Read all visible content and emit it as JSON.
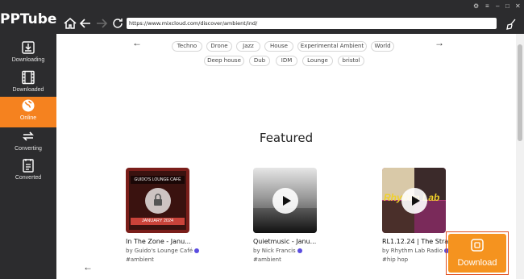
{
  "app": {
    "name": "PPTube"
  },
  "sidebar": {
    "items": [
      {
        "label": "Downloading",
        "icon": "download-icon"
      },
      {
        "label": "Downloaded",
        "icon": "film-icon"
      },
      {
        "label": "Online",
        "icon": "globe-icon",
        "active": true
      },
      {
        "label": "Converting",
        "icon": "convert-icon"
      },
      {
        "label": "Converted",
        "icon": "document-icon"
      }
    ]
  },
  "browser": {
    "url": "https://www.mixcloud.com/discover/ambient/ind/"
  },
  "tags_row1": [
    "Techno",
    "Drone",
    "Jazz",
    "House",
    "Experimental Ambient",
    "World"
  ],
  "tags_row2": [
    "Deep house",
    "Dub",
    "IDM",
    "Lounge",
    "bristol"
  ],
  "section_title": "Featured",
  "cards": [
    {
      "title": "In The Zone - Janu...",
      "by": "by Guido's Lounge Café",
      "tag": "#ambient",
      "art_text": "GUIDO'S LOUNGE CAFÉ",
      "art_sub": "JANUARY 2024"
    },
    {
      "title": "Quietmusic - Janu...",
      "by": "by Nick Francis",
      "tag": "#ambient"
    },
    {
      "title": "RL1.12.24 | The Stra...",
      "by": "by Rhythm Lab Radio",
      "tag": "#hip hop",
      "art_text": "Rhythm Lab"
    }
  ],
  "download_button": {
    "label": "Download"
  },
  "colors": {
    "accent": "#f5821f",
    "sidebar": "#2c2c2e",
    "verified": "#5b4de0"
  }
}
